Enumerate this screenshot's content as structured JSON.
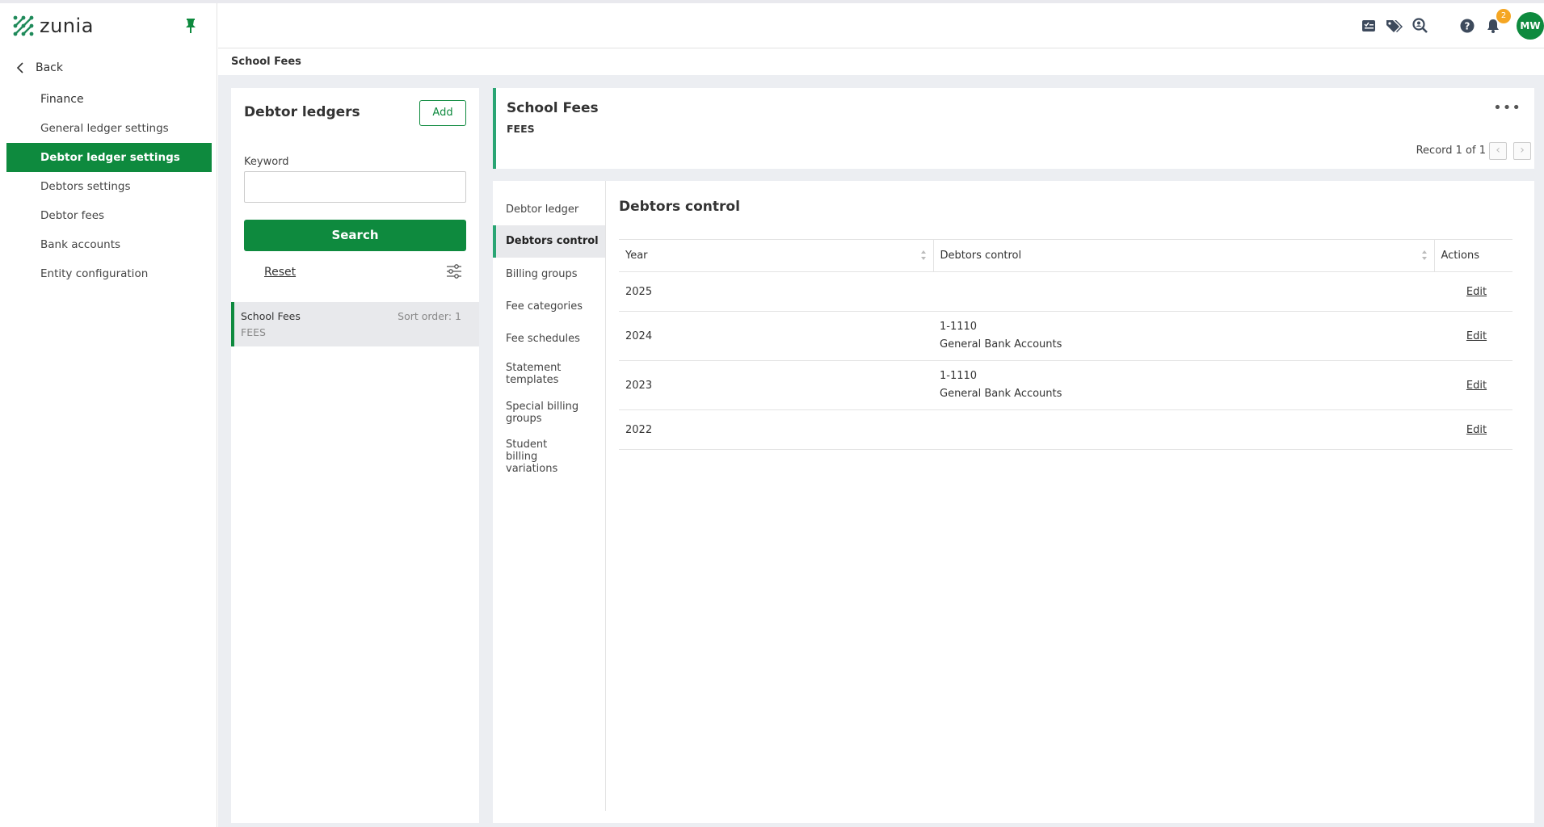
{
  "app": {
    "logo_text": "zunia",
    "brand_color": "#0e8a3e"
  },
  "sidebar": {
    "back_label": "Back",
    "section_label": "Finance",
    "items": [
      {
        "label": "General ledger settings"
      },
      {
        "label": "Debtor ledger settings",
        "active": true
      },
      {
        "label": "Debtors settings"
      },
      {
        "label": "Debtor fees"
      },
      {
        "label": "Bank accounts"
      },
      {
        "label": "Entity configuration"
      }
    ]
  },
  "header": {
    "icons": [
      "task-icon",
      "tags-icon",
      "search-person-icon",
      "help-icon",
      "bell-icon"
    ],
    "notification_count": "2",
    "avatar_initials": "MW"
  },
  "breadcrumb": {
    "current": "School Fees"
  },
  "left_panel": {
    "title": "Debtor ledgers",
    "add_label": "Add",
    "keyword_label": "Keyword",
    "keyword_value": "",
    "search_label": "Search",
    "reset_label": "Reset",
    "items": [
      {
        "name": "School Fees",
        "code": "FEES",
        "sort": "Sort order: 1"
      }
    ]
  },
  "record": {
    "title": "School Fees",
    "code": "FEES",
    "counter": "Record 1 of 1"
  },
  "detail": {
    "tabs": [
      {
        "label": "Debtor ledger"
      },
      {
        "label": "Debtors control",
        "active": true
      },
      {
        "label": "Billing groups"
      },
      {
        "label": "Fee categories"
      },
      {
        "label": "Fee schedules"
      },
      {
        "label": "Statement templates"
      },
      {
        "label": "Special billing groups"
      },
      {
        "label": "Student billing variations"
      }
    ],
    "section_title": "Debtors control",
    "columns": [
      "Year",
      "Debtors control",
      "Actions"
    ],
    "rows": [
      {
        "year": "2025",
        "account": "",
        "account_name": "",
        "action": "Edit"
      },
      {
        "year": "2024",
        "account": "1-1110",
        "account_name": "General Bank Accounts",
        "action": "Edit"
      },
      {
        "year": "2023",
        "account": "1-1110",
        "account_name": "General Bank Accounts",
        "action": "Edit"
      },
      {
        "year": "2022",
        "account": "",
        "account_name": "",
        "action": "Edit"
      }
    ]
  }
}
